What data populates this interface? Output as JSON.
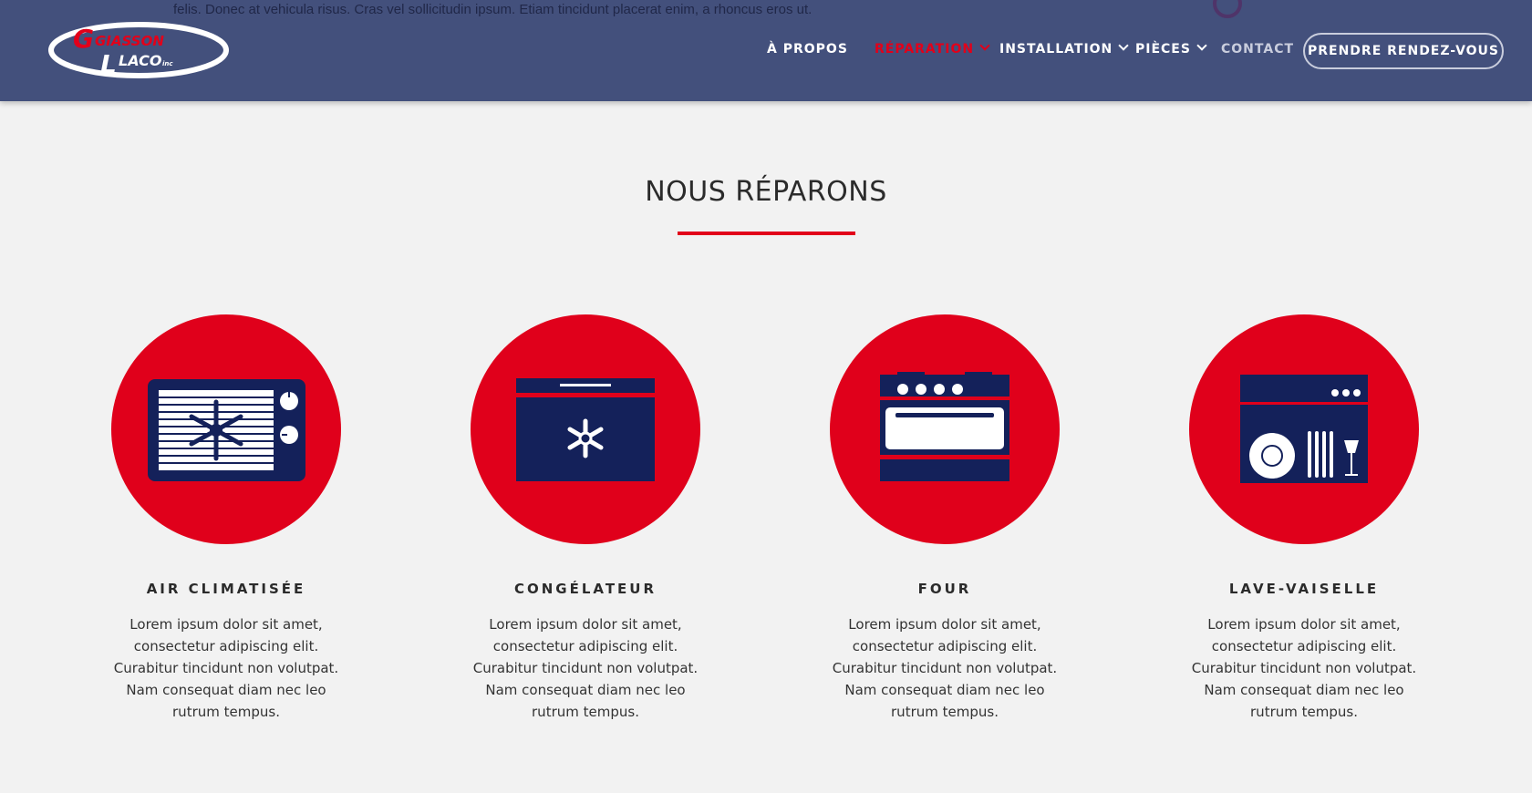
{
  "background_text": "felis. Donec at vehicula risus. Cras vel sollicitudin ipsum. Etiam tincidunt placerat enim, a rhoncus eros ut.",
  "logo": {
    "line1": "GIASSON",
    "line2": "LACO",
    "suffix": "inc"
  },
  "nav": {
    "items": [
      {
        "label": "À PROPOS",
        "dropdown": false
      },
      {
        "label": "RÉPARATION",
        "dropdown": true,
        "active": true
      },
      {
        "label": "INSTALLATION",
        "dropdown": true
      },
      {
        "label": "PIÈCES",
        "dropdown": true
      },
      {
        "label": "CONTACT",
        "dropdown": false
      }
    ],
    "cta_label": "PRENDRE RENDEZ-VOUS"
  },
  "section": {
    "title": "NOUS RÉPARONS",
    "cards": [
      {
        "title": "AIR CLIMATISÉE",
        "icon": "air-conditioner-icon",
        "text": "Lorem ipsum dolor sit amet, consectetur adipiscing elit. Curabitur tincidunt non volutpat. Nam consequat diam nec leo rutrum tempus."
      },
      {
        "title": "CONGÉLATEUR",
        "icon": "freezer-icon",
        "text": "Lorem ipsum dolor sit amet, consectetur adipiscing elit. Curabitur tincidunt non volutpat. Nam consequat diam nec leo rutrum tempus."
      },
      {
        "title": "FOUR",
        "icon": "oven-icon",
        "text": "Lorem ipsum dolor sit amet, consectetur adipiscing elit. Curabitur tincidunt non volutpat. Nam consequat diam nec leo rutrum tempus."
      },
      {
        "title": "LAVE-VAISELLE",
        "icon": "dishwasher-icon",
        "text": "Lorem ipsum dolor sit amet, consectetur adipiscing elit. Curabitur tincidunt non volutpat. Nam consequat diam nec leo rutrum tempus."
      }
    ]
  },
  "colors": {
    "header": "#43507c",
    "accent": "#e2001a",
    "navy": "#14215a",
    "background": "#f2f2f2"
  }
}
